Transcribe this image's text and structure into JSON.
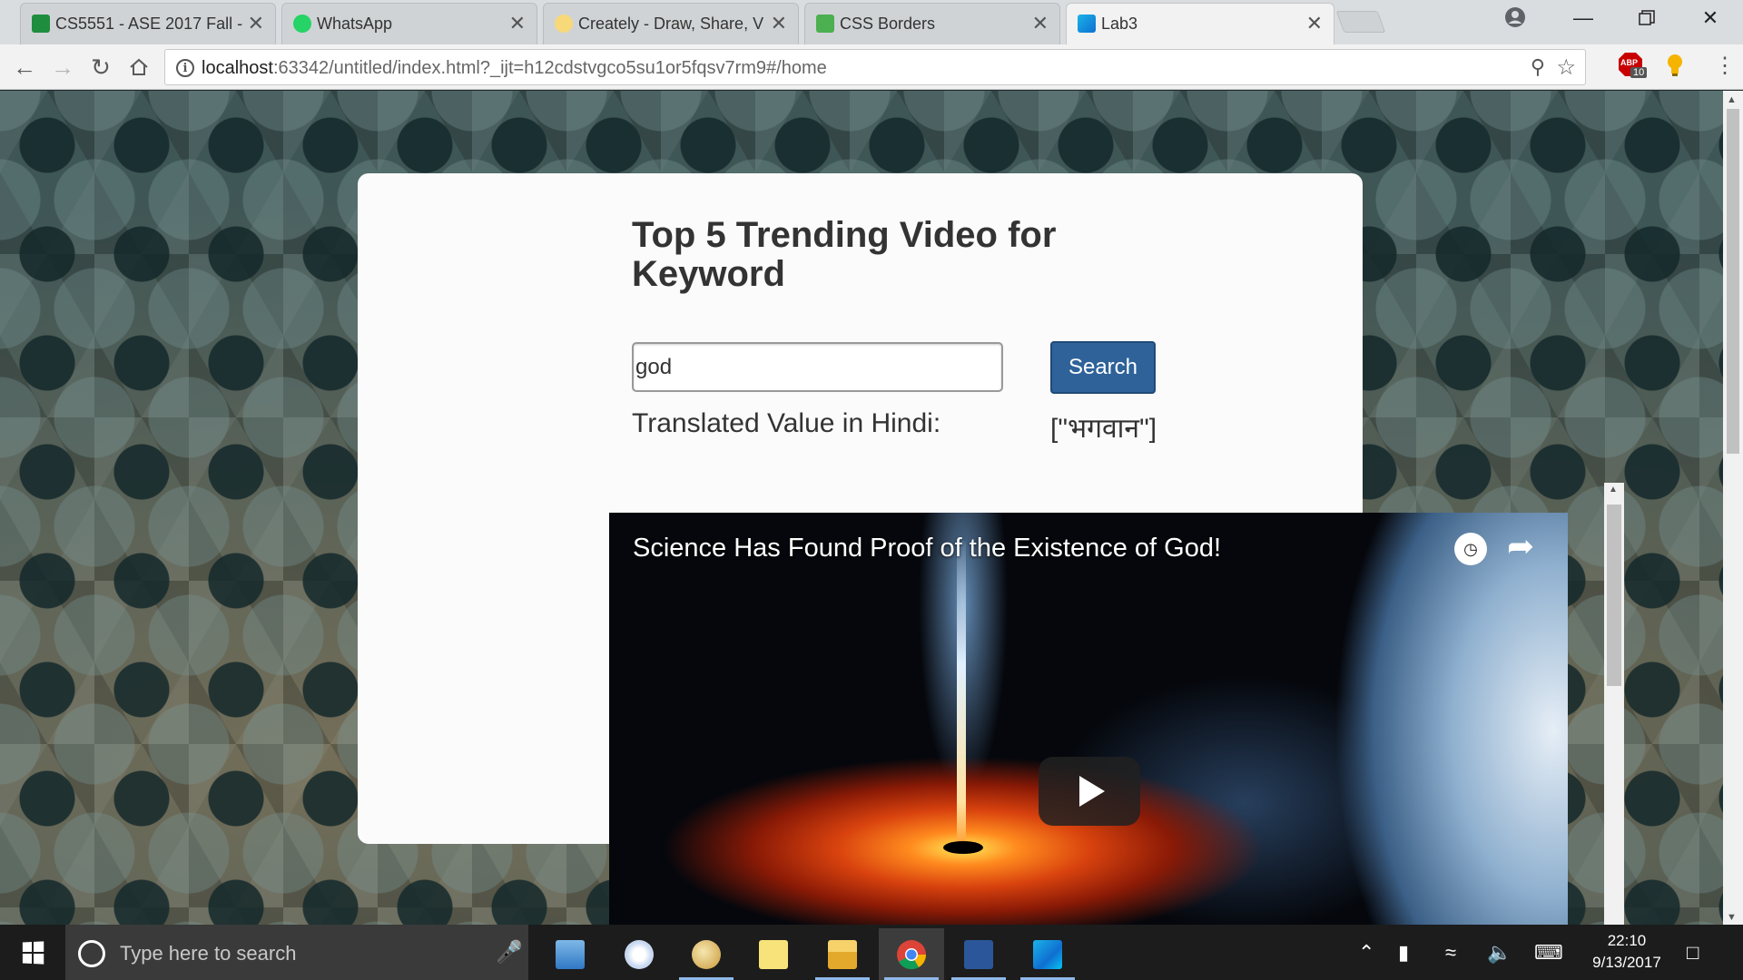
{
  "browser": {
    "tabs": [
      {
        "title": "CS5551 - ASE 2017 Fall -",
        "icon": "sheets-icon",
        "color": "#1e8e3e"
      },
      {
        "title": "WhatsApp",
        "icon": "whatsapp-icon",
        "color": "#25d366"
      },
      {
        "title": "Creately - Draw, Share, V",
        "icon": "creately-icon",
        "color": "#f7c948"
      },
      {
        "title": "CSS Borders",
        "icon": "w3schools-icon",
        "color": "#4caf50"
      },
      {
        "title": "Lab3",
        "icon": "webstorm-icon",
        "color": "#0f6fd1",
        "active": true
      }
    ],
    "close_glyph": "✕",
    "url_host": "localhost",
    "url_rest": ":63342/untitled/index.html?_ijt=h12cdstvgco5su1or5fqsv7rm9#/home",
    "extension_badge": "10",
    "abp_text": "ABP"
  },
  "page": {
    "heading": "Top 5 Trending Video for Keyword",
    "search": {
      "value": "god",
      "button_label": "Search"
    },
    "translation": {
      "label": "Translated Value in Hindi:",
      "value": "[\"भगवान\"]"
    },
    "video": {
      "title": "Science Has Found Proof of the Existence of God!"
    }
  },
  "taskbar": {
    "search_placeholder": "Type here to search",
    "time": "22:10",
    "date": "9/13/2017",
    "apps": [
      "control-panel-icon",
      "paint-icon",
      "paint-palette-icon",
      "sticky-notes-icon",
      "file-explorer-icon",
      "chrome-icon",
      "word-icon",
      "webstorm-icon"
    ]
  },
  "colors": {
    "accent_button": "#2e6299",
    "card": "#fbfbfb"
  }
}
